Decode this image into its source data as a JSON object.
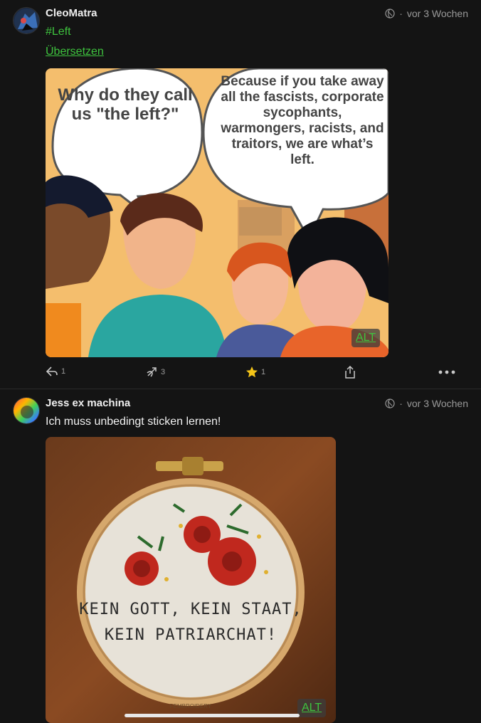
{
  "posts": [
    {
      "author": "CleoMatra",
      "time": "vor 3 Wochen",
      "hashtag": "#Left",
      "translate": "Übersetzen",
      "image": {
        "bubble_left": "Why do they call us \"the left?\"",
        "bubble_right": "Because if you take away all the fascists, corporate sycophants, warmongers, racists, and traitors, we are what’s left.",
        "alt": "ALT"
      },
      "actions": {
        "reply_count": "1",
        "boost_count": "3",
        "fav_count": "1"
      }
    },
    {
      "author": "Jess ex machina",
      "time": "vor 3 Wochen",
      "text": "Ich muss unbedingt sticken lernen!",
      "image": {
        "line1": "KEIN GOTT, KEIN STAAT,",
        "line2": "KEIN PATRIARCHAT!",
        "watermark": "FEMBROIDERY",
        "alt": "ALT"
      }
    }
  ],
  "icons": {
    "reply": "reply-icon",
    "boost": "boost-icon",
    "favourite": "star-icon",
    "share": "share-icon",
    "more": "more-icon",
    "visibility": "globe-icon"
  },
  "colors": {
    "background": "#141414",
    "link_green": "#3ec33e",
    "star": "#f5c518"
  }
}
